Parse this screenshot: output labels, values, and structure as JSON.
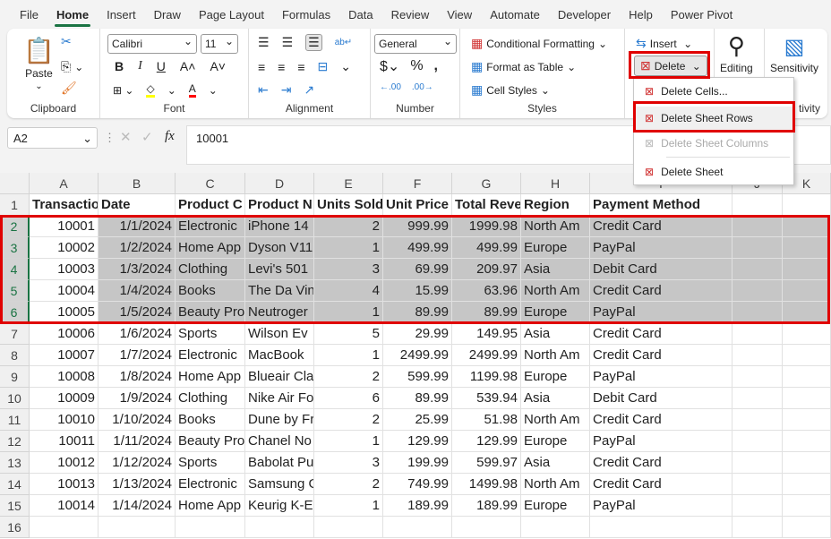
{
  "menu_tabs": [
    "File",
    "Home",
    "Insert",
    "Draw",
    "Page Layout",
    "Formulas",
    "Data",
    "Review",
    "View",
    "Automate",
    "Developer",
    "Help",
    "Power Pivot"
  ],
  "active_tab": "Home",
  "ribbon": {
    "clipboard": {
      "label": "Clipboard",
      "paste": "Paste"
    },
    "font": {
      "label": "Font",
      "name": "Calibri",
      "size": "11",
      "highlight_color": "#ffff00",
      "font_color": "#ff0000"
    },
    "alignment": {
      "label": "Alignment"
    },
    "number": {
      "label": "Number",
      "format": "General"
    },
    "styles": {
      "label": "Styles",
      "conditional": "Conditional Formatting",
      "format_table": "Format as Table",
      "cell_styles": "Cell Styles"
    },
    "cells": {
      "insert": "Insert",
      "delete": "Delete"
    },
    "editing": {
      "label": "Editing"
    },
    "sensitivity": {
      "label": "Sensitivity",
      "group_label": "tivity"
    }
  },
  "delete_menu": {
    "items": [
      {
        "label": "Delete Cells...",
        "disabled": false
      },
      {
        "label": "Delete Sheet Rows",
        "disabled": false,
        "highlighted": true
      },
      {
        "label": "Delete Sheet Columns",
        "disabled": true
      },
      {
        "label": "Delete Sheet",
        "disabled": false
      }
    ]
  },
  "formula_bar": {
    "name_box": "A2",
    "fx": "fx",
    "value": "10001"
  },
  "columns": [
    "A",
    "B",
    "C",
    "D",
    "E",
    "F",
    "G",
    "H",
    "I",
    "J",
    "K"
  ],
  "rows": [
    [
      "Transactio",
      "Date",
      "Product C",
      "Product N",
      "Units Sold",
      "Unit Price",
      "Total Reve",
      "Region",
      "Payment Method"
    ],
    [
      "10001",
      "1/1/2024",
      "Electronic",
      "iPhone 14",
      "2",
      "999.99",
      "1999.98",
      "North Am",
      "Credit Card"
    ],
    [
      "10002",
      "1/2/2024",
      "Home App",
      "Dyson V11",
      "1",
      "499.99",
      "499.99",
      "Europe",
      "PayPal"
    ],
    [
      "10003",
      "1/3/2024",
      "Clothing",
      "Levi's 501",
      "3",
      "69.99",
      "209.97",
      "Asia",
      "Debit Card"
    ],
    [
      "10004",
      "1/4/2024",
      "Books",
      "The Da Vin",
      "4",
      "15.99",
      "63.96",
      "North Am",
      "Credit Card"
    ],
    [
      "10005",
      "1/5/2024",
      "Beauty Pro",
      "Neutroger",
      "1",
      "89.99",
      "89.99",
      "Europe",
      "PayPal"
    ],
    [
      "10006",
      "1/6/2024",
      "Sports",
      "Wilson Ev",
      "5",
      "29.99",
      "149.95",
      "Asia",
      "Credit Card"
    ],
    [
      "10007",
      "1/7/2024",
      "Electronic",
      "MacBook",
      "1",
      "2499.99",
      "2499.99",
      "North Am",
      "Credit Card"
    ],
    [
      "10008",
      "1/8/2024",
      "Home App",
      "Blueair Cla",
      "2",
      "599.99",
      "1199.98",
      "Europe",
      "PayPal"
    ],
    [
      "10009",
      "1/9/2024",
      "Clothing",
      "Nike Air Fo",
      "6",
      "89.99",
      "539.94",
      "Asia",
      "Debit Card"
    ],
    [
      "10010",
      "1/10/2024",
      "Books",
      "Dune by Fr",
      "2",
      "25.99",
      "51.98",
      "North Am",
      "Credit Card"
    ],
    [
      "10011",
      "1/11/2024",
      "Beauty Pro",
      "Chanel No",
      "1",
      "129.99",
      "129.99",
      "Europe",
      "PayPal"
    ],
    [
      "10012",
      "1/12/2024",
      "Sports",
      "Babolat Pu",
      "3",
      "199.99",
      "599.97",
      "Asia",
      "Credit Card"
    ],
    [
      "10013",
      "1/13/2024",
      "Electronic",
      "Samsung G",
      "2",
      "749.99",
      "1499.98",
      "North Am",
      "Credit Card"
    ],
    [
      "10014",
      "1/14/2024",
      "Home App",
      "Keurig K-E",
      "1",
      "189.99",
      "189.99",
      "Europe",
      "PayPal"
    ],
    []
  ],
  "selected_rows": [
    2,
    3,
    4,
    5,
    6
  ],
  "active_cell": "A2",
  "highlight_color": "#e00000"
}
